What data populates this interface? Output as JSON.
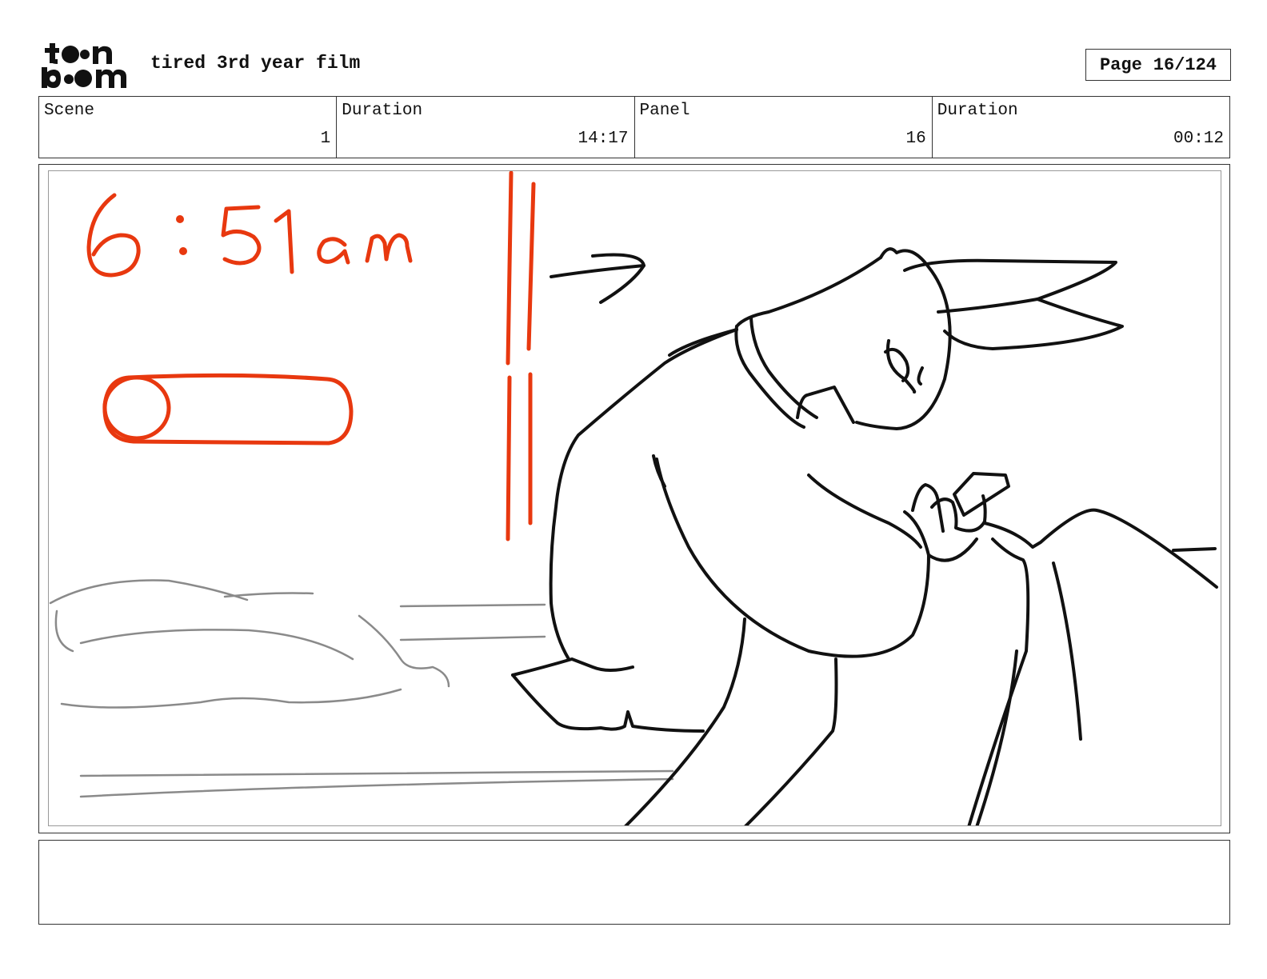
{
  "header": {
    "logo_text": "toon boom",
    "project_title": "tired 3rd year film",
    "page_label": "Page",
    "page_number": "16/124"
  },
  "info": {
    "scene_label": "Scene",
    "scene_value": "1",
    "scene_duration_label": "Duration",
    "scene_duration_value": "14:17",
    "panel_label": "Panel",
    "panel_value": "16",
    "panel_duration_label": "Duration",
    "panel_duration_value": "00:12"
  },
  "panel": {
    "sketch_time_text": "6:51am",
    "sketch_color": "#e8380f"
  },
  "notes": {
    "text": ""
  }
}
